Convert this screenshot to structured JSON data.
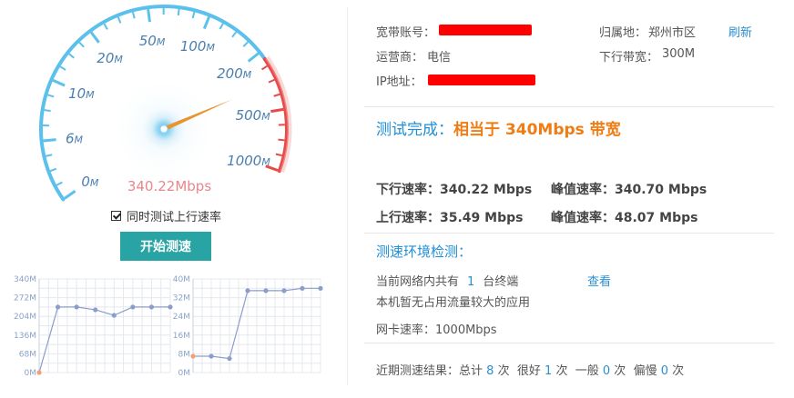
{
  "gauge": {
    "ticks": [
      "0M",
      "6M",
      "10M",
      "20M",
      "50M",
      "100M",
      "200M",
      "500M",
      "1000M"
    ],
    "reading": "340.22Mbps",
    "needle_fraction": 0.815,
    "colors": {
      "arc": "#5bc0eb",
      "arc_red": "#e84a4a",
      "needle": "#e89430",
      "reading": "#e8878b",
      "tick_text": "#4a7fb0"
    }
  },
  "options": {
    "upload_test_label": "同时测试上行速率",
    "upload_test_checked": true
  },
  "start_button": "开始测速",
  "info": {
    "account_label": "宽带账号：",
    "isp_label": "运营商：",
    "isp_value": "电信",
    "ip_label": "IP地址：",
    "location_label": "归属地：",
    "location_value": "郑州市区",
    "refresh_label": "刷新",
    "down_bw_label": "下行带宽：",
    "down_bw_value": "300M"
  },
  "result": {
    "prefix": "测试完成：",
    "highlight": "相当于 340Mbps 带宽"
  },
  "rates": {
    "down_label": "下行速率：",
    "down_value": "340.22 Mbps",
    "peak1_label": "峰值速率：",
    "peak1_value": "340.70 Mbps",
    "up_label": "上行速率：",
    "up_value": "35.49 Mbps",
    "peak2_label": "峰值速率：",
    "peak2_value": "48.07 Mbps"
  },
  "env": {
    "title": "测速环境检测：",
    "devices_prefix": "当前网络内共有",
    "devices_count": "1",
    "devices_suffix": "台终端",
    "view_link": "查看",
    "apps_text": "本机暂无占用流量较大的应用",
    "nic_text": "网卡速率：1000Mbps"
  },
  "history": {
    "prefix": "近期测速结果：总计",
    "total": "8",
    "unit1": "次",
    "good_label": "很好",
    "good": "1",
    "unit2": "次",
    "normal_label": "一般",
    "normal": "0",
    "unit3": "次",
    "slow_label": "偏慢",
    "slow": "0",
    "unit4": "次"
  },
  "chart_data": [
    {
      "type": "line",
      "title": "",
      "ylim": [
        0,
        340
      ],
      "y_ticks": [
        "0M",
        "68M",
        "136M",
        "204M",
        "272M",
        "340M"
      ],
      "series": [
        {
          "values": [
            0,
            238,
            238,
            228,
            208,
            238,
            238,
            238
          ]
        }
      ]
    },
    {
      "type": "line",
      "title": "",
      "ylim": [
        0,
        40
      ],
      "y_ticks": [
        "0M",
        "8M",
        "16M",
        "24M",
        "32M",
        "40M"
      ],
      "series": [
        {
          "values": [
            7,
            7,
            6,
            35,
            35,
            35,
            36,
            36
          ]
        }
      ]
    }
  ]
}
